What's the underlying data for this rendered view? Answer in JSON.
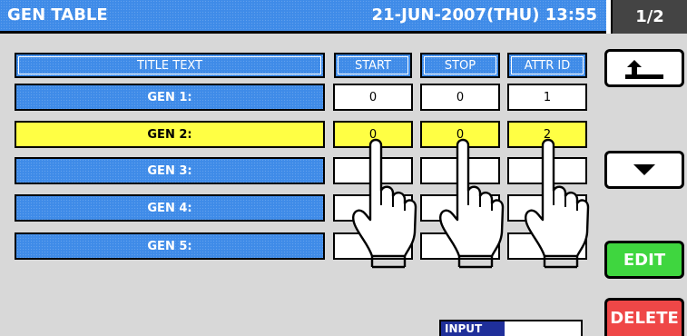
{
  "header": {
    "title": "GEN TABLE",
    "datetime": "21-JUN-2007(THU) 13:55",
    "page": "1/2"
  },
  "table": {
    "columns": [
      "TITLE TEXT",
      "START",
      "STOP",
      "ATTR ID"
    ],
    "rows": [
      {
        "title": "GEN 1:",
        "start": "0",
        "stop": "0",
        "attr": "1"
      },
      {
        "title": "GEN 2:",
        "start": "0",
        "stop": "0",
        "attr": "2"
      },
      {
        "title": "GEN 3:",
        "start": "",
        "stop": "",
        "attr": "9"
      },
      {
        "title": "GEN 4:",
        "start": "",
        "stop": "",
        "attr": ""
      },
      {
        "title": "GEN 5:",
        "start": "",
        "stop": "",
        "attr": ""
      }
    ],
    "selected_row": "GEN 2:"
  },
  "buttons": {
    "edit": "EDIT",
    "delete": "DELETE",
    "back_icon": "back-arrow-icon",
    "down_icon": "down-triangle-icon"
  },
  "input": {
    "label": "INPUT",
    "value": ""
  },
  "colors": {
    "title_blue": "#3f8be8",
    "selected_yellow": "#ffff44",
    "edit_green": "#3fd63f",
    "delete_red": "#ef4747"
  }
}
